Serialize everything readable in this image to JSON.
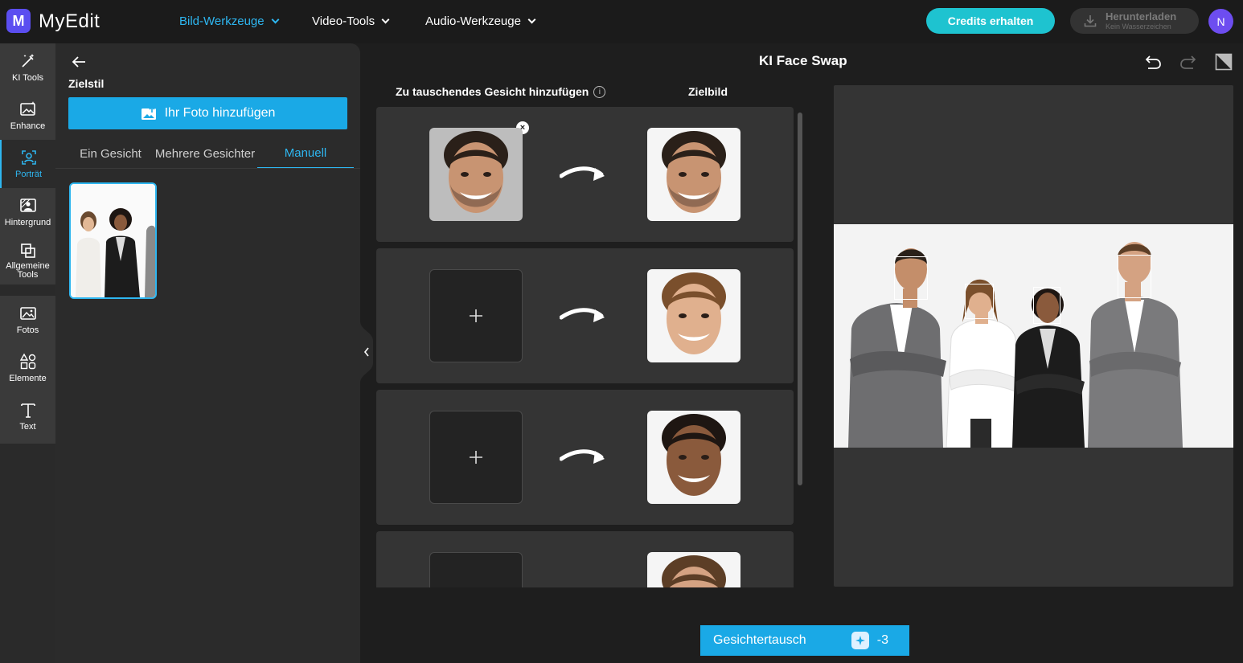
{
  "app": {
    "logo_letter": "M",
    "name": "MyEdit"
  },
  "nav": {
    "items": [
      {
        "label": "Bild-Werkzeuge",
        "active": true
      },
      {
        "label": "Video-Tools",
        "active": false
      },
      {
        "label": "Audio-Werkzeuge",
        "active": false
      }
    ],
    "credits_button": "Credits erhalten",
    "download_main": "Herunterladen",
    "download_sub": "Kein Wasserzeichen",
    "avatar_letter": "N"
  },
  "rail": {
    "items": [
      {
        "label": "KI Tools",
        "icon": "magic-wand-icon"
      },
      {
        "label": "Enhance",
        "icon": "enhance-image-icon"
      },
      {
        "label": "Porträt",
        "icon": "portrait-icon",
        "active": true
      },
      {
        "label": "Hintergrund",
        "icon": "background-icon"
      },
      {
        "label": "Allgemeine Tools",
        "icon": "general-tools-icon"
      },
      {
        "label": "Fotos",
        "icon": "photos-icon"
      },
      {
        "label": "Elemente",
        "icon": "elements-icon"
      },
      {
        "label": "Text",
        "icon": "text-icon"
      }
    ],
    "plus": "+"
  },
  "panel": {
    "section_title": "Zielstil",
    "add_photo_label": "Ihr Foto hinzufügen",
    "tabs": [
      {
        "label": "Ein Gesicht",
        "active": false
      },
      {
        "label": "Mehrere Gesichter",
        "active": false
      },
      {
        "label": "Manuell",
        "active": true
      }
    ]
  },
  "main": {
    "title": "KI Face Swap",
    "col_source": "Zu tauschendes Gesicht hinzufügen",
    "col_info": "i",
    "col_target": "Zielbild",
    "rows": [
      {
        "source": "filled",
        "target_skin": "#c89472",
        "target_hair": "#2a2019"
      },
      {
        "source": "empty",
        "target_skin": "#e0b08e",
        "target_hair": "#7a4f2c"
      },
      {
        "source": "empty",
        "target_skin": "#8a5a3c",
        "target_hair": "#1e1612"
      },
      {
        "source": "empty",
        "target_skin": "#d4a282",
        "target_hair": "#5c3e26"
      }
    ],
    "remove_symbol": "×",
    "swap_button": "Gesichtertausch",
    "swap_cost": "-3"
  },
  "colors": {
    "accent": "#2eb6f0",
    "button": "#1aa9e6",
    "credits": "#1ec3d0",
    "avatar": "#6d4df0",
    "logo": "#5b4ef0"
  }
}
